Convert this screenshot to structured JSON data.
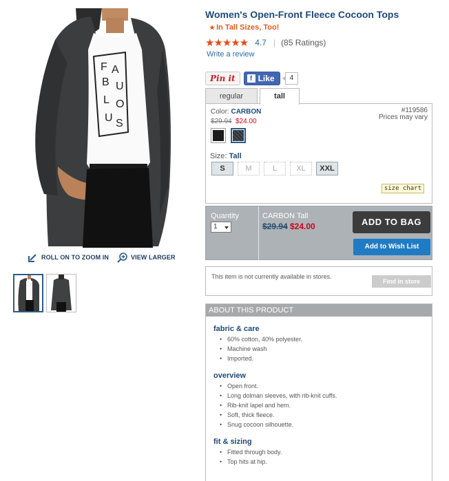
{
  "product": {
    "title": "Women's Open-Front Fleece Cocoon Tops",
    "tall_note": "In Tall Sizes, Too!",
    "tall_star": "★",
    "stars": "★★★★★",
    "rating_score": "4.7",
    "rating_count": "(85 Ratings)",
    "write_review": "Write a review"
  },
  "image": {
    "shirt_text": [
      "F",
      "A",
      "B",
      "U",
      "L",
      "O",
      "U",
      "S"
    ]
  },
  "zoom": {
    "roll_on": "ROLL ON TO ZOOM IN",
    "view_larger": "VIEW LARGER"
  },
  "social": {
    "pinit": "Pin it",
    "fb_like": "Like",
    "fb_icon": "f",
    "fb_count": "4"
  },
  "tabs": [
    {
      "label": "regular",
      "active": false
    },
    {
      "label": "tall",
      "active": true
    }
  ],
  "options": {
    "color_prefix": "Color:",
    "color_name": "CARBON",
    "price_old": "$29.94",
    "price_new": "$24.00",
    "sku": "#119586",
    "may_vary": "Prices may vary",
    "swatches": [
      {
        "name": "black",
        "color": "#1c1c1c",
        "selected": false
      },
      {
        "name": "carbon",
        "color": "#3a3d40",
        "selected": true
      }
    ],
    "size_prefix": "Size:",
    "size_name": "Tall",
    "sizes": [
      {
        "label": "S",
        "available": true
      },
      {
        "label": "M",
        "available": false
      },
      {
        "label": "L",
        "available": false
      },
      {
        "label": "XL",
        "available": false
      },
      {
        "label": "XXL",
        "available": true
      }
    ],
    "size_chart": "size chart"
  },
  "buy": {
    "qty_label": "Quantity",
    "qty_value": "1",
    "name": "CARBON Tall",
    "price_old": "$29.94",
    "price_new": "$24.00",
    "add_to_bag": "ADD TO BAG",
    "add_to_wish": "Add to Wish List"
  },
  "store": {
    "message": "This item is not currently available in stores.",
    "find": "Find in store"
  },
  "about": {
    "header": "ABOUT THIS PRODUCT",
    "sections": [
      {
        "title": "fabric & care",
        "items": [
          "60% cotton, 40% polyester.",
          "Machine wash",
          "Imported."
        ]
      },
      {
        "title": "overview",
        "items": [
          "Open front.",
          "Long dolman sleeves, with rib-knit cuffs.",
          "Rib-knit lapel and hem.",
          "Soft, thick fleece.",
          "Snug cocoon silhouette."
        ]
      },
      {
        "title": "fit & sizing",
        "items": [
          "Fitted through body.",
          "Top hits at hip."
        ]
      }
    ]
  },
  "colors": {
    "title_blue": "#1e4a78",
    "accent_orange": "#e05b1b",
    "sale_red": "#d0021b",
    "bag_button": "#3c3c3c",
    "wish_button": "#1e7bc4"
  }
}
